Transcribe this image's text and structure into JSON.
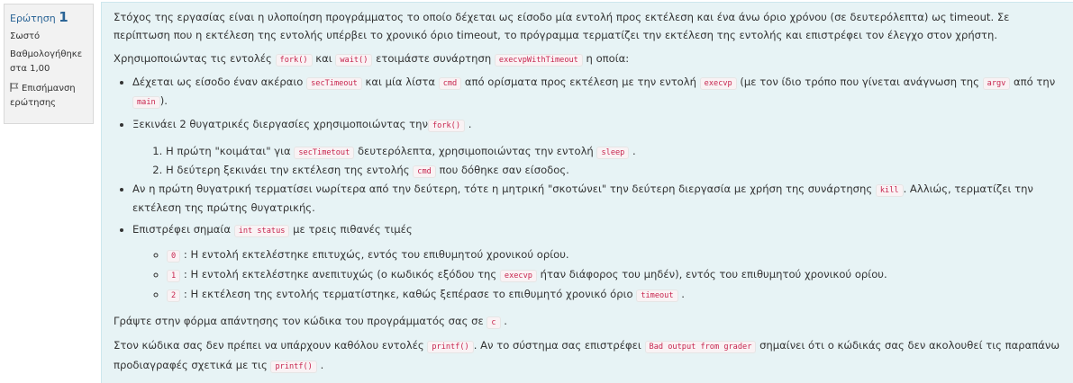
{
  "info": {
    "question_label": "Ερώτηση",
    "question_number": "1",
    "state": "Σωστό",
    "grade_label": "Βαθμολογήθηκε στα 1,00",
    "flag_label": "Επισήμανση ερώτησης"
  },
  "question": {
    "p1": "Στόχος της εργασίας είναι η υλοποίηση προγράμματος το οποίο δέχεται ως είσοδο μία εντολή προς εκτέλεση και ένα άνω όριο χρόνου (σε δευτερόλεπτα) ως timeout. Σε περίπτωση που η εκτέλεση της εντολής υπέρβει το χρονικό όριο timeout, το πρόγραμμα τερματίζει την εκτέλεση της εντολής και επιστρέφει τον έλεγχο στον χρήστη.",
    "p2": {
      "t1": "Χρησιμοποιώντας τις εντολές",
      "c1": "fork()",
      "t2": "και",
      "c2": "wait()",
      "t3": "ετοιμάστε συνάρτηση",
      "c3": "execvpWithTimeout",
      "t4": "η οποία:"
    },
    "b1": {
      "t1": "Δέχεται ως είσοδο έναν ακέραιο",
      "c1": "secTimeout",
      "t2": "και μία λίστα",
      "c2": "cmd",
      "t3": "από ορίσματα προς εκτέλεση με την εντολή",
      "c3": "execvp",
      "t4": "(με τον ίδιο τρόπο που γίνεται ανάγνωση της",
      "c4": "argv",
      "t5": "από την",
      "c5": "main",
      "t6": ")."
    },
    "b2": {
      "t1": "Ξεκινάει 2 θυγατρικές διεργασίες χρησιμοποιώντας την",
      "c1": "fork()",
      "t2": "."
    },
    "o1": {
      "t1": "Η πρώτη \"κοιμάται\" για",
      "c1": "secTimetout",
      "t2": "δευτερόλεπτα, χρησιμοποιώντας την εντολή",
      "c2": "sleep",
      "t3": "."
    },
    "o2": {
      "t1": "Η δεύτερη ξεκινάει την εκτέλεση της εντολής",
      "c1": "cmd",
      "t2": "που δόθηκε σαν είσοδος."
    },
    "b3": {
      "t1": "Αν η πρώτη θυγατρική τερματίσει νωρίτερα από την δεύτερη, τότε η μητρική \"σκοτώνει\" την δεύτερη διεργασία με χρήση της συνάρτησης",
      "c1": "kill",
      "t2": ". Αλλιώς, τερματίζει την εκτέλεση της πρώτης θυγατρικής."
    },
    "b4": {
      "t1": "Επιστρέφει σημαία",
      "c1": "int status",
      "t2": "με τρεις πιθανές τιμές"
    },
    "s1": {
      "c1": "0",
      "t1": ": Η εντολή εκτελέστηκε επιτυχώς, εντός του επιθυμητού χρονικού ορίου."
    },
    "s2": {
      "c1": "1",
      "t1": ": Η εντολή εκτελέστηκε ανεπιτυχώς (ο κωδικός εξόδου της",
      "c2": "execvp",
      "t2": "ήταν διάφορος του μηδέν), εντός του επιθυμητού χρονικού ορίου."
    },
    "s3": {
      "c1": "2",
      "t1": ": Η εκτέλεση της εντολής τερματίστηκε, καθώς ξεπέρασε το επιθυμητό χρονικό όριο",
      "c2": "timeout",
      "t2": "."
    },
    "p3": {
      "t1": "Γράψτε στην φόρμα απάντησης τον κώδικα του προγράμματός σας σε",
      "c1": "c",
      "t2": "."
    },
    "p4": {
      "t1": "Στον κώδικα σας δεν πρέπει να υπάρχουν καθόλου εντολές",
      "c1": "printf()",
      "t2": ". Αν το σύστημα σας επιστρέφει",
      "c2": "Bad output from grader",
      "t3": "σημαίνει ότι ο κώδικάς σας δεν ακολουθεί τις παραπάνω προδιαγραφές σχετικά με τις",
      "c3": "printf()",
      "t4": "."
    }
  },
  "colors": {
    "info_bg": "#f2f2f2",
    "content_bg": "#e7f3f5",
    "code_text": "#c7254e",
    "link": "#2a6496"
  }
}
